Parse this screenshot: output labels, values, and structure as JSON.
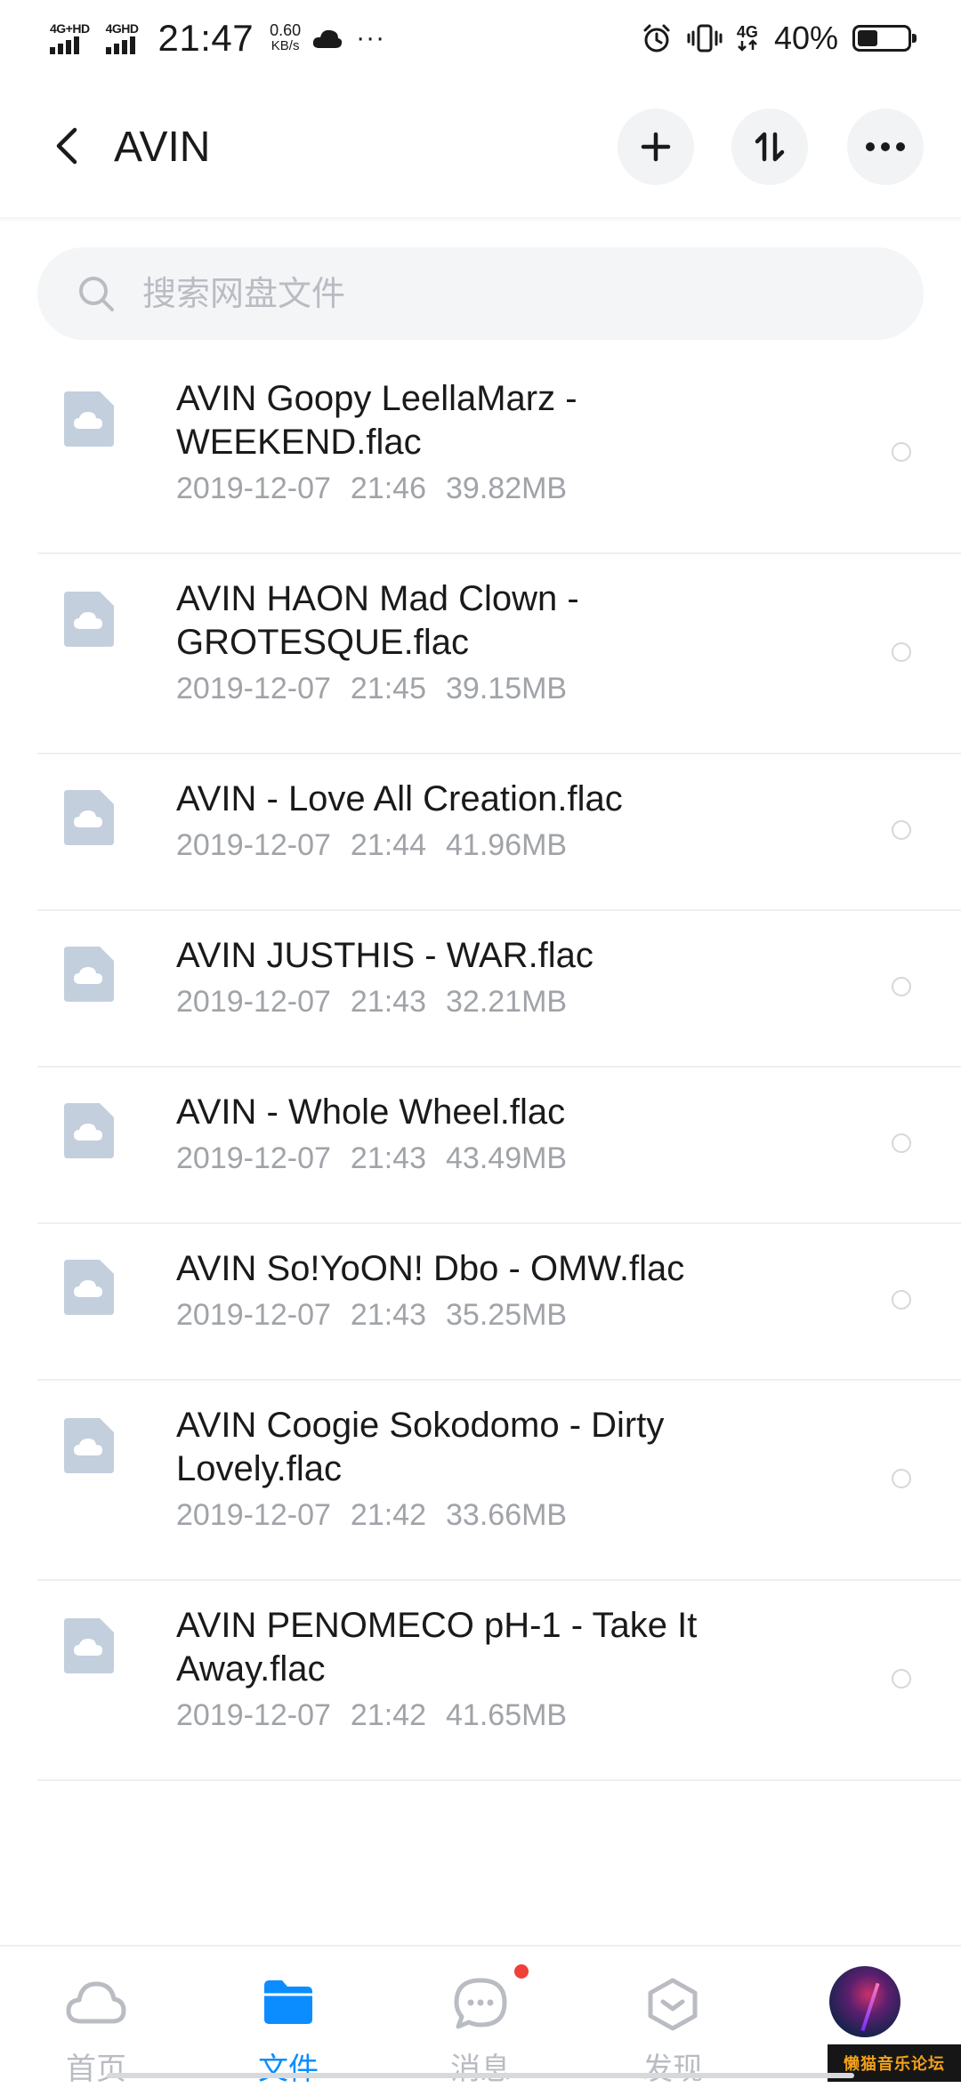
{
  "status_bar": {
    "network1": "4G+HD",
    "network2": "4GHD",
    "time": "21:47",
    "speed_value": "0.60",
    "speed_unit": "KB/s",
    "more": "···",
    "data_type": "4G",
    "battery_percent": "40%",
    "battery_level": 0.4
  },
  "header": {
    "title": "AVIN"
  },
  "search": {
    "placeholder": "搜索网盘文件"
  },
  "files": [
    {
      "name": "AVIN Goopy LeellaMarz - WEEKEND.flac",
      "date": "2019-12-07",
      "time": "21:46",
      "size": "39.82MB"
    },
    {
      "name": "AVIN HAON Mad Clown - GROTESQUE.flac",
      "date": "2019-12-07",
      "time": "21:45",
      "size": "39.15MB"
    },
    {
      "name": "AVIN - Love All Creation.flac",
      "date": "2019-12-07",
      "time": "21:44",
      "size": "41.96MB"
    },
    {
      "name": "AVIN JUSTHIS - WAR.flac",
      "date": "2019-12-07",
      "time": "21:43",
      "size": "32.21MB"
    },
    {
      "name": "AVIN - Whole Wheel.flac",
      "date": "2019-12-07",
      "time": "21:43",
      "size": "43.49MB"
    },
    {
      "name": "AVIN So!YoON! Dbo - OMW.flac",
      "date": "2019-12-07",
      "time": "21:43",
      "size": "35.25MB"
    },
    {
      "name": "AVIN Coogie Sokodomo - Dirty Lovely.flac",
      "date": "2019-12-07",
      "time": "21:42",
      "size": "33.66MB"
    },
    {
      "name": "AVIN PENOMECO pH-1 - Take It Away.flac",
      "date": "2019-12-07",
      "time": "21:42",
      "size": "41.65MB"
    }
  ],
  "bottom_nav": [
    {
      "label": "首页",
      "icon": "cloud-icon"
    },
    {
      "label": "文件",
      "icon": "folder-icon"
    },
    {
      "label": "消息",
      "icon": "chat-icon"
    },
    {
      "label": "发现",
      "icon": "compass-icon"
    }
  ],
  "colors": {
    "accent": "#0b8dff",
    "badge": "#f0403a"
  },
  "watermark": "懒猫音乐论坛"
}
